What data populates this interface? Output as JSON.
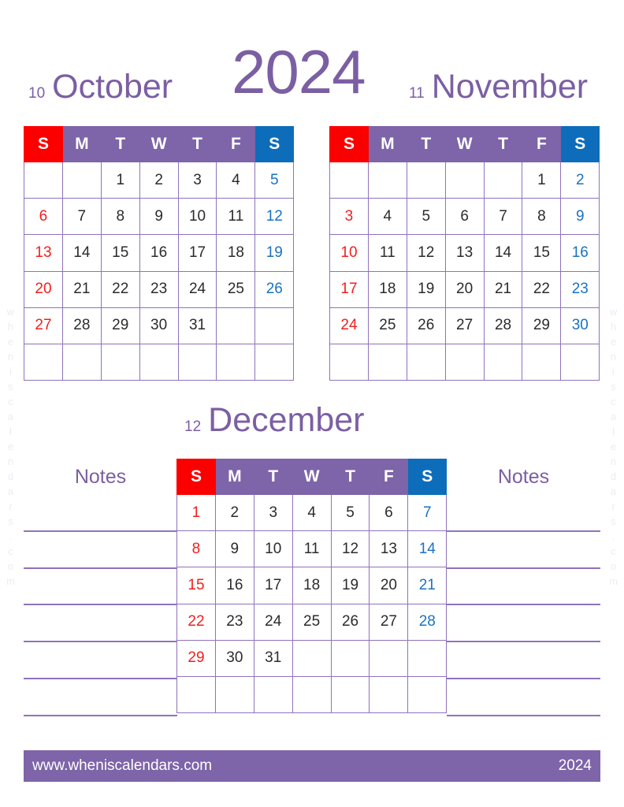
{
  "document": {
    "title": "2024",
    "year": "2024",
    "accent_purple": "#7e64a8",
    "title_purple": "#7b5fa3",
    "grid_border": "#8f73bb",
    "sunday_red": "#fc0000",
    "saturday_blue": "#0d6dba"
  },
  "watermark": {
    "text": "wheniscalendars.com"
  },
  "weekdays": [
    "S",
    "M",
    "T",
    "W",
    "T",
    "F",
    "S"
  ],
  "months": [
    {
      "number": "10",
      "name": "October",
      "weeks": [
        [
          "",
          "",
          "1",
          "2",
          "3",
          "4",
          "5"
        ],
        [
          "6",
          "7",
          "8",
          "9",
          "10",
          "11",
          "12"
        ],
        [
          "13",
          "14",
          "15",
          "16",
          "17",
          "18",
          "19"
        ],
        [
          "20",
          "21",
          "22",
          "23",
          "24",
          "25",
          "26"
        ],
        [
          "27",
          "28",
          "29",
          "30",
          "31",
          "",
          ""
        ],
        [
          "",
          "",
          "",
          "",
          "",
          "",
          ""
        ]
      ]
    },
    {
      "number": "11",
      "name": "November",
      "weeks": [
        [
          "",
          "",
          "",
          "",
          "",
          "1",
          "2"
        ],
        [
          "3",
          "4",
          "5",
          "6",
          "7",
          "8",
          "9"
        ],
        [
          "10",
          "11",
          "12",
          "13",
          "14",
          "15",
          "16"
        ],
        [
          "17",
          "18",
          "19",
          "20",
          "21",
          "22",
          "23"
        ],
        [
          "24",
          "25",
          "26",
          "27",
          "28",
          "29",
          "30"
        ],
        [
          "",
          "",
          "",
          "",
          "",
          "",
          ""
        ]
      ]
    },
    {
      "number": "12",
      "name": "December",
      "weeks": [
        [
          "1",
          "2",
          "3",
          "4",
          "5",
          "6",
          "7"
        ],
        [
          "8",
          "9",
          "10",
          "11",
          "12",
          "13",
          "14"
        ],
        [
          "15",
          "16",
          "17",
          "18",
          "19",
          "20",
          "21"
        ],
        [
          "22",
          "23",
          "24",
          "25",
          "26",
          "27",
          "28"
        ],
        [
          "29",
          "30",
          "31",
          "",
          "",
          "",
          ""
        ],
        [
          "",
          "",
          "",
          "",
          "",
          "",
          ""
        ]
      ]
    }
  ],
  "notes": {
    "left_title": "Notes",
    "right_title": "Notes",
    "line_count": 6
  },
  "footer": {
    "url": "www.wheniscalendars.com",
    "year": "2024"
  }
}
